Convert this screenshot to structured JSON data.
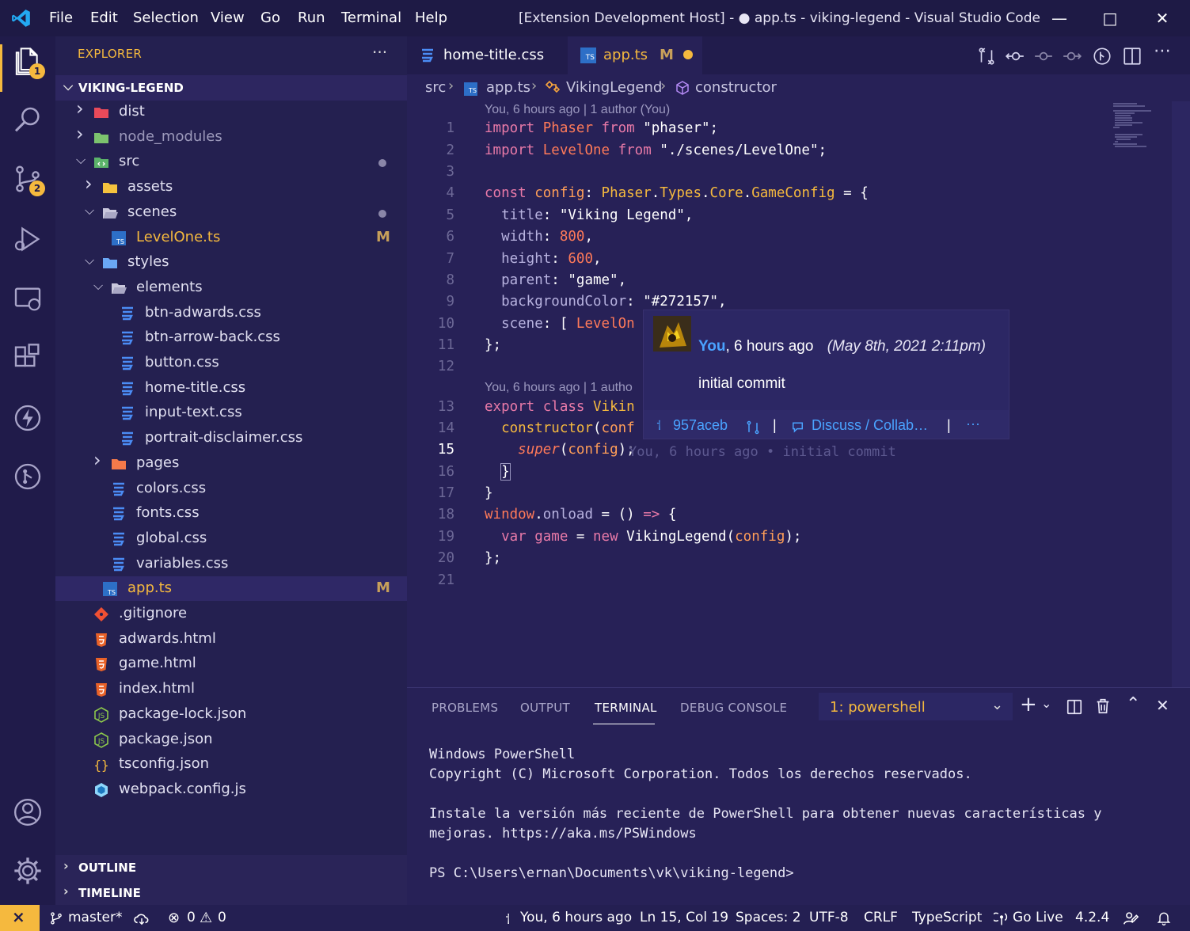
{
  "titlebar": {
    "menu": [
      "File",
      "Edit",
      "Selection",
      "View",
      "Go",
      "Run",
      "Terminal",
      "Help"
    ],
    "title": "[Extension Development Host] - ● app.ts - viking-legend - Visual Studio Code"
  },
  "activity": {
    "explorer_badge": "1",
    "scm_badge": "2"
  },
  "sidebar": {
    "header": "EXPLORER",
    "dots": "···",
    "root": "VIKING-LEGEND",
    "tree": [
      {
        "name": "dist",
        "chev": ">",
        "icon": "folder-red-icon",
        "mark": ""
      },
      {
        "name": "node_modules",
        "chev": ">",
        "icon": "folder-green-icon",
        "mark": "",
        "dim": true
      },
      {
        "name": "src",
        "chev": "v",
        "icon": "folder-src-icon",
        "mark": "dot"
      },
      {
        "name": "assets",
        "chev": ">",
        "icon": "folder-yellow-icon",
        "mark": ""
      },
      {
        "name": "scenes",
        "chev": "v",
        "icon": "folder-open-icon",
        "mark": "dot"
      },
      {
        "name": "LevelOne.ts",
        "chev": "",
        "icon": "ts-file-icon",
        "mark": "M",
        "modified": true
      },
      {
        "name": "styles",
        "chev": "v",
        "icon": "folder-blue-icon",
        "mark": ""
      },
      {
        "name": "elements",
        "chev": "v",
        "icon": "folder-open-icon",
        "mark": ""
      },
      {
        "name": "btn-adwards.css",
        "chev": "",
        "icon": "css-file-icon",
        "mark": ""
      },
      {
        "name": "btn-arrow-back.css",
        "chev": "",
        "icon": "css-file-icon",
        "mark": ""
      },
      {
        "name": "button.css",
        "chev": "",
        "icon": "css-file-icon",
        "mark": ""
      },
      {
        "name": "home-title.css",
        "chev": "",
        "icon": "css-file-icon",
        "mark": ""
      },
      {
        "name": "input-text.css",
        "chev": "",
        "icon": "css-file-icon",
        "mark": ""
      },
      {
        "name": "portrait-disclaimer.css",
        "chev": "",
        "icon": "css-file-icon",
        "mark": ""
      },
      {
        "name": "pages",
        "chev": ">",
        "icon": "folder-orange-icon",
        "mark": ""
      },
      {
        "name": "colors.css",
        "chev": "",
        "icon": "css-file-icon",
        "mark": ""
      },
      {
        "name": "fonts.css",
        "chev": "",
        "icon": "css-file-icon",
        "mark": ""
      },
      {
        "name": "global.css",
        "chev": "",
        "icon": "css-file-icon",
        "mark": ""
      },
      {
        "name": "variables.css",
        "chev": "",
        "icon": "css-file-icon",
        "mark": ""
      },
      {
        "name": "app.ts",
        "chev": "",
        "icon": "ts-file-icon",
        "mark": "M",
        "modified": true,
        "selected": true
      },
      {
        "name": ".gitignore",
        "chev": "",
        "icon": "git-icon",
        "mark": ""
      },
      {
        "name": "adwards.html",
        "chev": "",
        "icon": "html-file-icon",
        "mark": ""
      },
      {
        "name": "game.html",
        "chev": "",
        "icon": "html-file-icon",
        "mark": ""
      },
      {
        "name": "index.html",
        "chev": "",
        "icon": "html-file-icon",
        "mark": ""
      },
      {
        "name": "package-lock.json",
        "chev": "",
        "icon": "node-json-icon",
        "mark": ""
      },
      {
        "name": "package.json",
        "chev": "",
        "icon": "node-json-icon",
        "mark": ""
      },
      {
        "name": "tsconfig.json",
        "chev": "",
        "icon": "json-braces-icon",
        "mark": ""
      },
      {
        "name": "webpack.config.js",
        "chev": "",
        "icon": "webpack-icon",
        "mark": ""
      }
    ],
    "outline": "OUTLINE",
    "timeline": "TIMELINE"
  },
  "tabs": [
    {
      "label": "home-title.css",
      "icon": "css-file-icon"
    },
    {
      "label": "app.ts",
      "icon": "ts-file-icon",
      "mark": "M"
    }
  ],
  "breadcrumb": {
    "src": "src",
    "file": "app.ts",
    "cls": "VikingLegend",
    "method": "constructor"
  },
  "editor": {
    "lens1": "You, 6 hours ago | 1 author (You)",
    "lens2": "You, 6 hours ago | 1 autho",
    "line_numbers": [
      "1",
      "2",
      "3",
      "4",
      "5",
      "6",
      "7",
      "8",
      "9",
      "10",
      "11",
      "12",
      "13",
      "14",
      "15",
      "16",
      "17",
      "18",
      "19",
      "20",
      "21"
    ],
    "inline_blame": "You, 6 hours ago • initial commit"
  },
  "hover": {
    "author": "You",
    "ago": ", 6 hours ago",
    "date": "(May 8th, 2021 2:11pm)",
    "message": "initial commit",
    "sha": "957aceb",
    "discuss": "Discuss / Collab…",
    "sep": "|",
    "more": "···"
  },
  "panel": {
    "tabs": [
      "PROBLEMS",
      "OUTPUT",
      "TERMINAL",
      "DEBUG CONSOLE"
    ],
    "terminal_select": "1: powershell",
    "terminal_lines": [
      "Windows PowerShell",
      "Copyright (C) Microsoft Corporation. Todos los derechos reservados.",
      "",
      "Instale la versión más reciente de PowerShell para obtener nuevas características y",
      "mejoras. https://aka.ms/PSWindows",
      "",
      "PS C:\\Users\\ernan\\Documents\\vk\\viking-legend>"
    ]
  },
  "status": {
    "branch": "master*",
    "errors": "0",
    "warnings": "0",
    "blame": "You, 6 hours ago",
    "position": "Ln 15, Col 19",
    "spaces": "Spaces: 2",
    "encoding": "UTF-8",
    "eol": "CRLF",
    "language": "TypeScript",
    "golive": "Go Live",
    "version": "4.2.4"
  }
}
